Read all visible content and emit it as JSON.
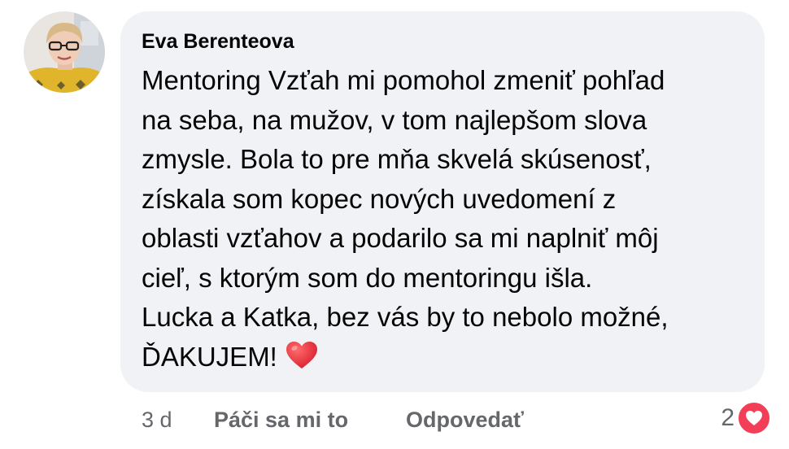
{
  "comment": {
    "author": "Eva Berenteova",
    "text_lines": [
      "Mentoring Vzťah mi pomohol zmeniť pohľad",
      "na seba, na mužov, v tom najlepšom slova",
      "zmysle. Bola to pre mňa skvelá skúsenosť,",
      "získala som kopec nových uvedomení z",
      "oblasti vzťahov a podarilo sa mi naplniť môj",
      "cieľ, s ktorým som do mentoringu išla.",
      "Lucka a Katka, bez vás by to nebolo možné,",
      "ĎAKUJEM!"
    ],
    "trailing_emoji": "red-heart-emoji"
  },
  "actions": {
    "timestamp": "3 d",
    "like_label": "Páči sa mi to",
    "reply_label": "Odpovedať"
  },
  "reactions": {
    "count": "2",
    "icon": "heart-reaction-icon",
    "color": "#f33e58"
  },
  "colors": {
    "bubble_background": "#f0f2f5",
    "text_primary": "#050505",
    "text_secondary": "#65676b"
  }
}
